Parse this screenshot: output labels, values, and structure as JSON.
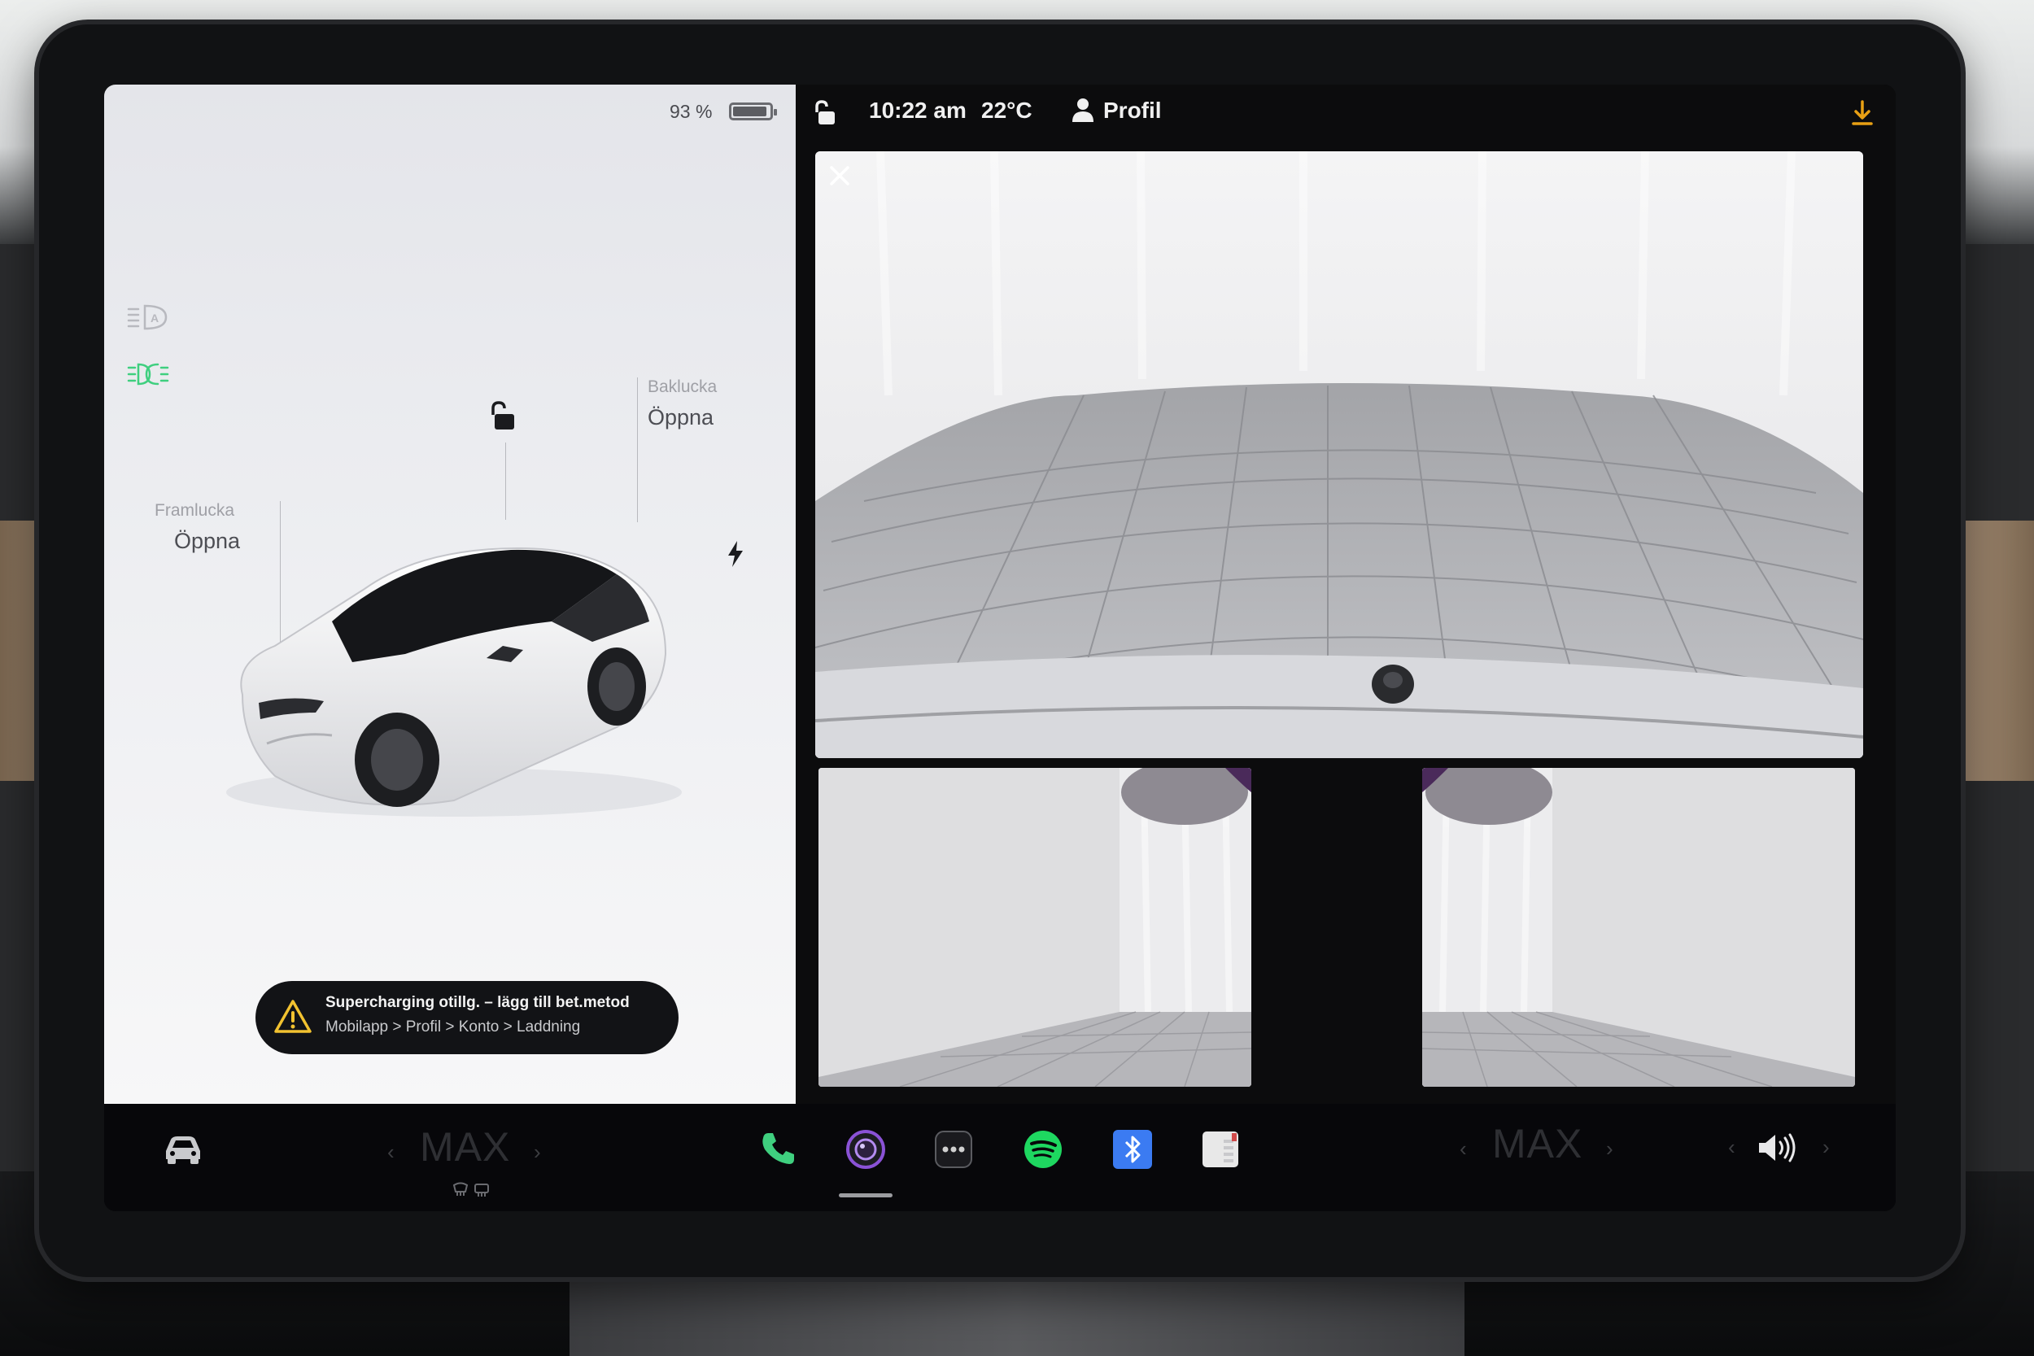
{
  "left_panel": {
    "battery": {
      "percent_text": "93 %",
      "level": 0.93
    },
    "lights": {
      "auto_icon": "auto-headlight-icon",
      "parking_icon": "parking-light-icon",
      "parking_color": "#3fcf7f"
    },
    "lock_icon": "unlock-icon",
    "trunk": {
      "title": "Baklucka",
      "action": "Öppna"
    },
    "frunk": {
      "title": "Framlucka",
      "action": "Öppna"
    },
    "charge_icon": "lightning-icon",
    "notification": {
      "title": "Supercharging otillg. – lägg till bet.metod",
      "path": "Mobilapp > Profil > Konto > Laddning",
      "icon": "warning-icon"
    }
  },
  "status_bar": {
    "lock_icon": "unlock-icon",
    "time": "10:22 am",
    "temperature": "22°C",
    "profile_icon": "person-icon",
    "profile_label": "Profil",
    "download_icon": "download-icon",
    "download_color": "#e8a014"
  },
  "camera": {
    "close_icon": "close-icon",
    "views": [
      "rear-camera",
      "left-repeater-camera",
      "right-repeater-camera"
    ]
  },
  "dock": {
    "car_icon": "car-icon",
    "driver_temp": {
      "label": "MAX",
      "left": "‹",
      "right": "›"
    },
    "defrost_icons": [
      "front-defrost-icon",
      "rear-defrost-icon"
    ],
    "apps": [
      {
        "name": "phone-icon",
        "color": "#3fcf7f"
      },
      {
        "name": "camera-icon",
        "color": "#8a52d6"
      },
      {
        "name": "more-apps-icon",
        "color": "#d0d0d0"
      },
      {
        "name": "spotify-icon",
        "color": "#1ed760"
      },
      {
        "name": "bluetooth-icon",
        "color": "#3b7bf2"
      },
      {
        "name": "calendar-icon",
        "color": "#e8e8e8"
      }
    ],
    "passenger_temp": {
      "label": "MAX",
      "left": "‹",
      "right": "›"
    },
    "volume": {
      "left": "‹",
      "right": "›",
      "icon": "volume-icon"
    }
  }
}
